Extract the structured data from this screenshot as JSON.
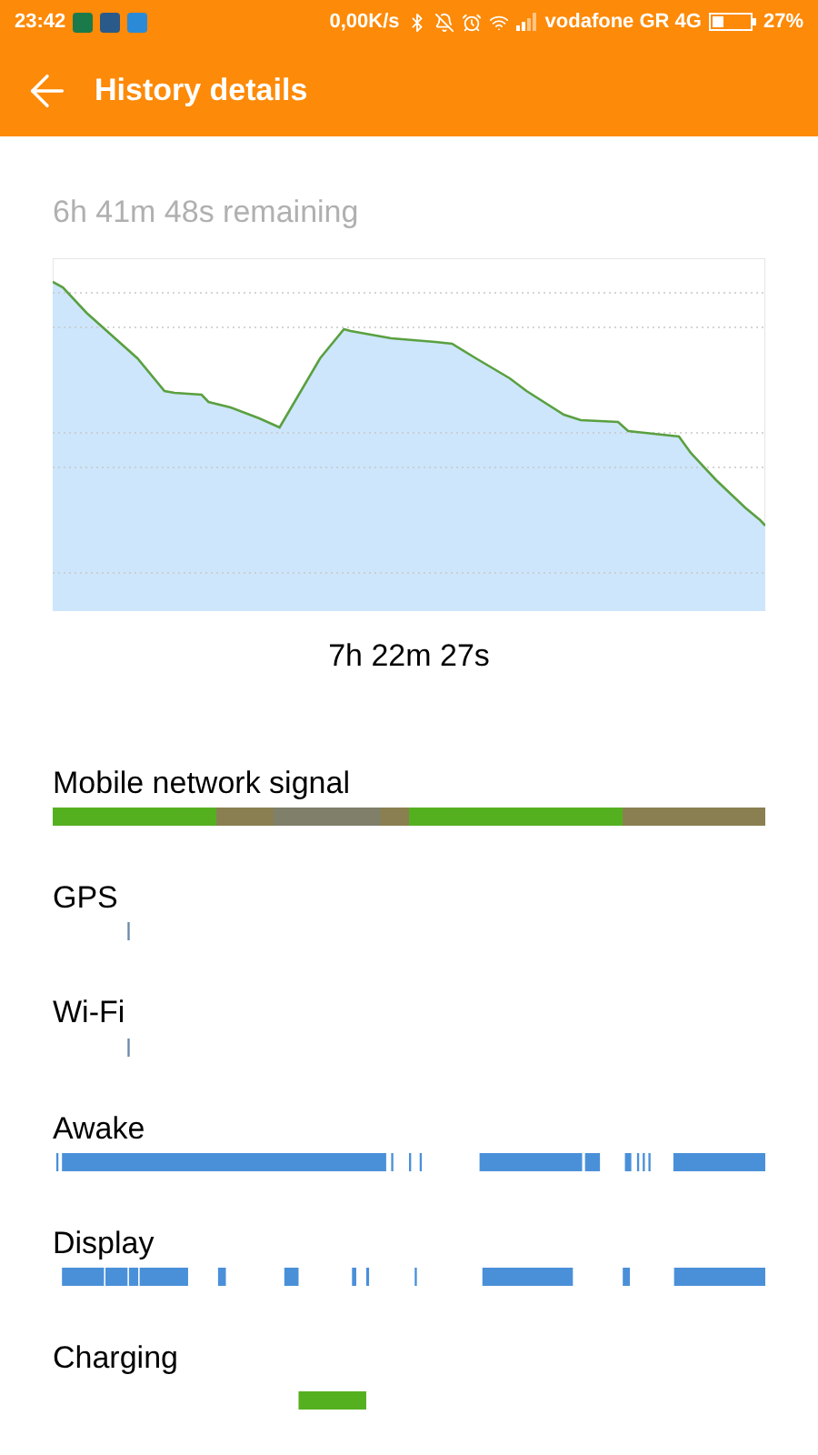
{
  "status_bar": {
    "time": "23:42",
    "speed": "0,00K/s",
    "carrier": "vodafone GR 4G",
    "battery": "27%"
  },
  "app_bar": {
    "title": "History details"
  },
  "remaining": "6h 41m 48s remaining",
  "chart": {
    "duration": "7h 22m 27s"
  },
  "timelines": [
    {
      "label": "Mobile network signal",
      "kind": "signal"
    },
    {
      "label": "GPS",
      "kind": "gps"
    },
    {
      "label": "Wi-Fi",
      "kind": "wifi"
    },
    {
      "label": "Awake",
      "kind": "awake"
    },
    {
      "label": "Display",
      "kind": "display"
    },
    {
      "label": "Charging",
      "kind": "charging"
    }
  ]
}
